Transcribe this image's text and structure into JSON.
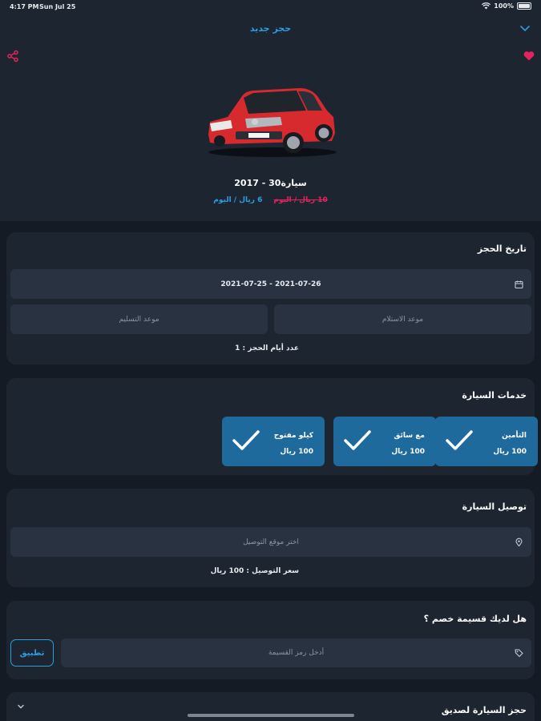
{
  "status_bar": {
    "time": "4:17 PM",
    "date": "Sun Jul 25",
    "battery": "100%"
  },
  "header": {
    "title": "حجز جديد"
  },
  "car": {
    "title": "سيارة30  -  2017",
    "old_price": "10 ريال / اليوم",
    "new_price": "6 ريال / اليوم"
  },
  "booking_date": {
    "title": "تاريخ الحجز",
    "date_range": "2021-07-25  -  2021-07-26",
    "pickup_time_placeholder": "موعد الاستلام",
    "delivery_time_placeholder": "موعد التسليم",
    "days_count": "عدد أيام الحجز : 1"
  },
  "services": {
    "title": "خدمات السيارة",
    "items": [
      {
        "name": "التأمين",
        "price": "100 ريال"
      },
      {
        "name": "مع سائق",
        "price": "100 ريال"
      },
      {
        "name": "كيلو مفتوح",
        "price": "100 ريال"
      }
    ]
  },
  "delivery": {
    "title": "توصيل السيارة",
    "location_placeholder": "اختر موقع التوصيل",
    "delivery_price": "سعر التوصيل : 100 ريال"
  },
  "coupon": {
    "title": "هل لديك قسيمة خصم ؟",
    "code_placeholder": "أدخل رمز القسيمة",
    "apply_label": "تطبيق"
  },
  "friend_booking": {
    "title": "حجز السيارة لصديق"
  },
  "colors": {
    "accent": "#2e9de0",
    "sale": "#e2245f",
    "service_tile": "#1f6a9c",
    "card": "#1d2530",
    "background": "#151b24"
  },
  "icons": {
    "back": "chevron-down-icon",
    "share": "share-icon",
    "favorite": "heart-icon",
    "calendar": "calendar-icon",
    "location": "location-pin-icon",
    "tag": "tag-icon",
    "check": "check-icon"
  }
}
